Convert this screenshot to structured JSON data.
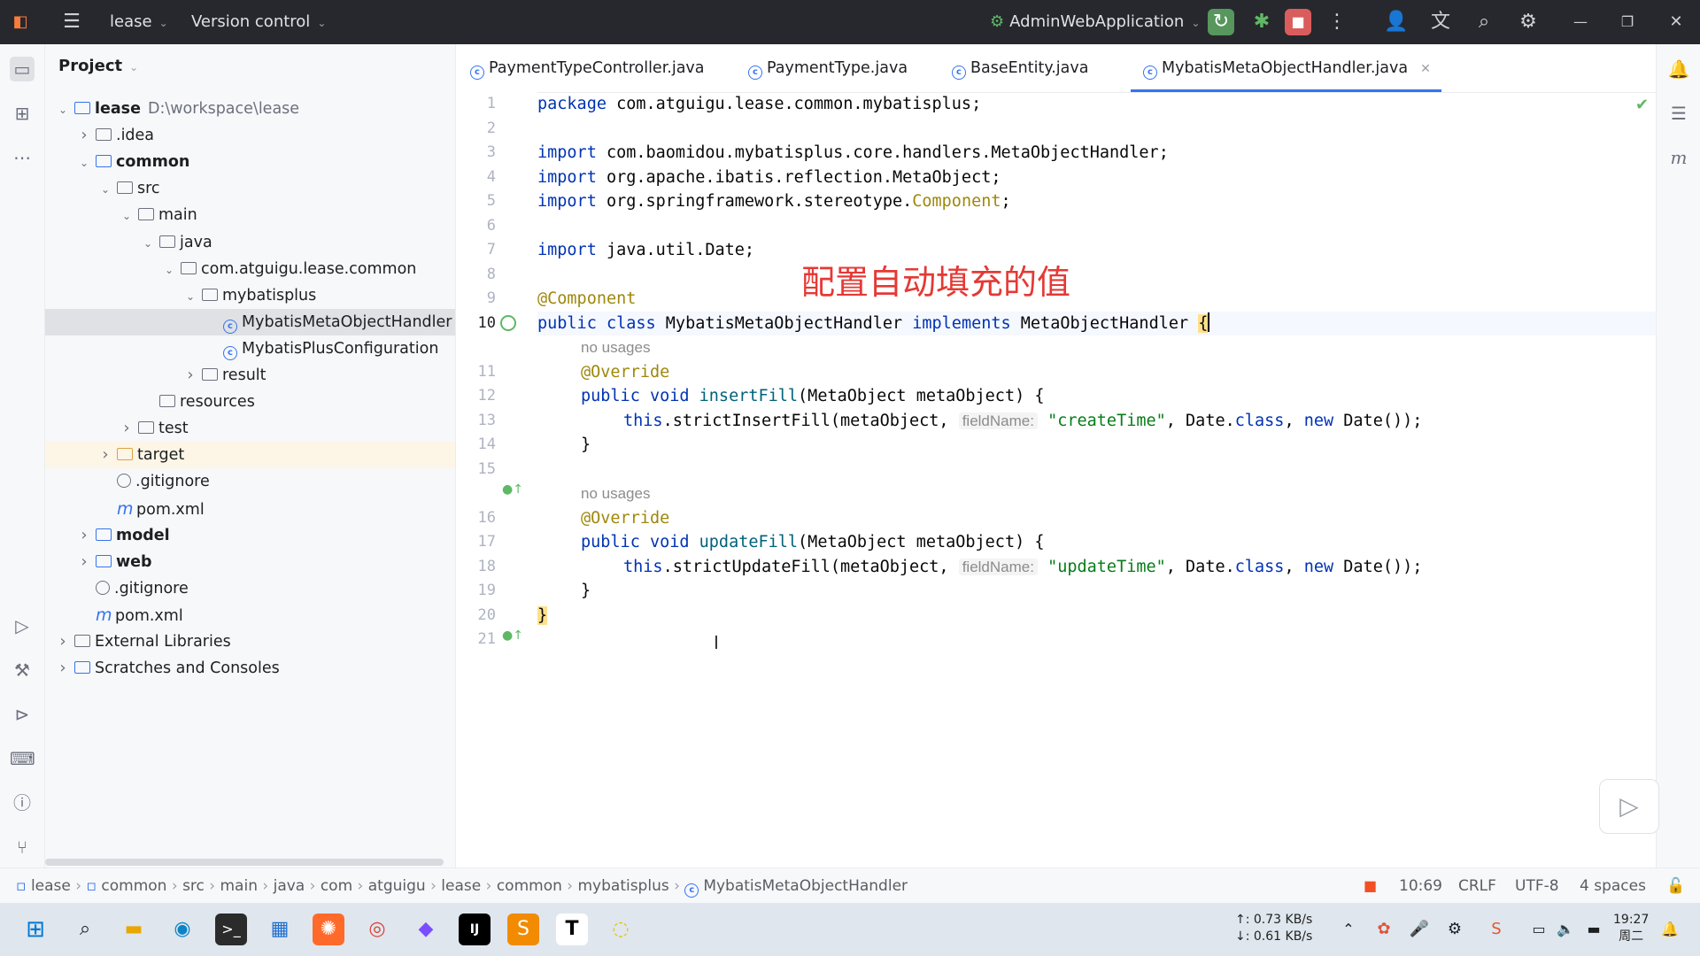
{
  "titlebar": {
    "project_label": "lease",
    "vcs_label": "Version control",
    "run_config": "AdminWebApplication"
  },
  "project_panel": {
    "title": "Project",
    "tree": [
      {
        "label": "lease",
        "extra": "D:\\workspace\\lease",
        "level": 0,
        "type": "module",
        "expanded": true,
        "bold": true
      },
      {
        "label": ".idea",
        "level": 1,
        "type": "folder",
        "collapsed": true
      },
      {
        "label": "common",
        "level": 1,
        "type": "module",
        "expanded": true,
        "bold": true
      },
      {
        "label": "src",
        "level": 2,
        "type": "folder",
        "expanded": true
      },
      {
        "label": "main",
        "level": 3,
        "type": "folder",
        "expanded": true
      },
      {
        "label": "java",
        "level": 4,
        "type": "folder",
        "expanded": true
      },
      {
        "label": "com.atguigu.lease.common",
        "level": 5,
        "type": "package",
        "expanded": true
      },
      {
        "label": "mybatisplus",
        "level": 6,
        "type": "package",
        "expanded": true
      },
      {
        "label": "MybatisMetaObjectHandler",
        "level": 7,
        "type": "class",
        "selected": true
      },
      {
        "label": "MybatisPlusConfiguration",
        "level": 7,
        "type": "class"
      },
      {
        "label": "result",
        "level": 6,
        "type": "package",
        "collapsed": true
      },
      {
        "label": "resources",
        "level": 4,
        "type": "folder"
      },
      {
        "label": "test",
        "level": 3,
        "type": "folder",
        "collapsed": true
      },
      {
        "label": "target",
        "level": 2,
        "type": "folder",
        "collapsed": true,
        "highlight": true
      },
      {
        "label": ".gitignore",
        "level": 2,
        "type": "ignore"
      },
      {
        "label": "pom.xml",
        "level": 2,
        "type": "maven"
      },
      {
        "label": "model",
        "level": 1,
        "type": "module",
        "collapsed": true,
        "bold": true
      },
      {
        "label": "web",
        "level": 1,
        "type": "module",
        "collapsed": true,
        "bold": true
      },
      {
        "label": ".gitignore",
        "level": 1,
        "type": "ignore"
      },
      {
        "label": "pom.xml",
        "level": 1,
        "type": "maven"
      },
      {
        "label": "External Libraries",
        "level": 0,
        "type": "libs",
        "collapsed": true
      },
      {
        "label": "Scratches and Consoles",
        "level": 0,
        "type": "scratch",
        "collapsed": true
      }
    ]
  },
  "tabs": [
    {
      "label": "PaymentTypeController.java"
    },
    {
      "label": "PaymentType.java"
    },
    {
      "label": "BaseEntity.java"
    },
    {
      "label": "MybatisMetaObjectHandler.java",
      "active": true
    }
  ],
  "editor": {
    "line_numbers": [
      "1",
      "2",
      "3",
      "4",
      "5",
      "6",
      "7",
      "8",
      "9",
      "10",
      "",
      "11",
      "12",
      "13",
      "14",
      "15",
      "",
      "16",
      "17",
      "18",
      "19",
      "20",
      "21"
    ],
    "code": {
      "pkg_kw": "package",
      "pkg": " com.atguigu.lease.common.mybatisplus;",
      "imp": "import",
      "imp1": " com.baomidou.mybatisplus.core.handlers.MetaObjectHandler;",
      "imp2": " org.apache.ibatis.reflection.MetaObject;",
      "imp3a": " org.springframework.stereotype.",
      "imp3b": "Component",
      "imp3c": ";",
      "imp4": " java.util.Date;",
      "ann_component": "@Component",
      "public": "public",
      "class_kw": " class",
      "class_name": " MybatisMetaObjectHandler ",
      "implements": "implements",
      "iface": " MetaObjectHandler ",
      "brace_open": "{",
      "brace_close": "}",
      "no_usages": "no usages",
      "override": "@Override",
      "void_kw": " void ",
      "insert_sig": "insertFill",
      "update_sig": "updateFill",
      "params": "(MetaObject metaObject) {",
      "this_kw": "this",
      "strict_insert": ".strictInsertFill(metaObject, ",
      "strict_update": ".strictUpdateFill(metaObject, ",
      "hint_fieldname": "fieldName:",
      "str_create": "\"createTime\"",
      "str_update": "\"updateTime\"",
      "date_class": ", Date.",
      "class_lit": "class",
      "comma": ", ",
      "new_kw": "new",
      "new_date": " Date());",
      "inner_close": "}"
    },
    "overlay_caption": "配置自动填充的值"
  },
  "statusbar": {
    "breadcrumbs": [
      "lease",
      "common",
      "src",
      "main",
      "java",
      "com",
      "atguigu",
      "lease",
      "common",
      "mybatisplus",
      "MybatisMetaObjectHandler"
    ],
    "position": "10:69",
    "line_sep": "CRLF",
    "encoding": "UTF-8",
    "indent": "4 spaces"
  },
  "taskbar": {
    "net_up": "↑: 0.73 KB/s",
    "net_down": "↓: 0.61 KB/s",
    "time": "19:27",
    "day": "周二"
  }
}
